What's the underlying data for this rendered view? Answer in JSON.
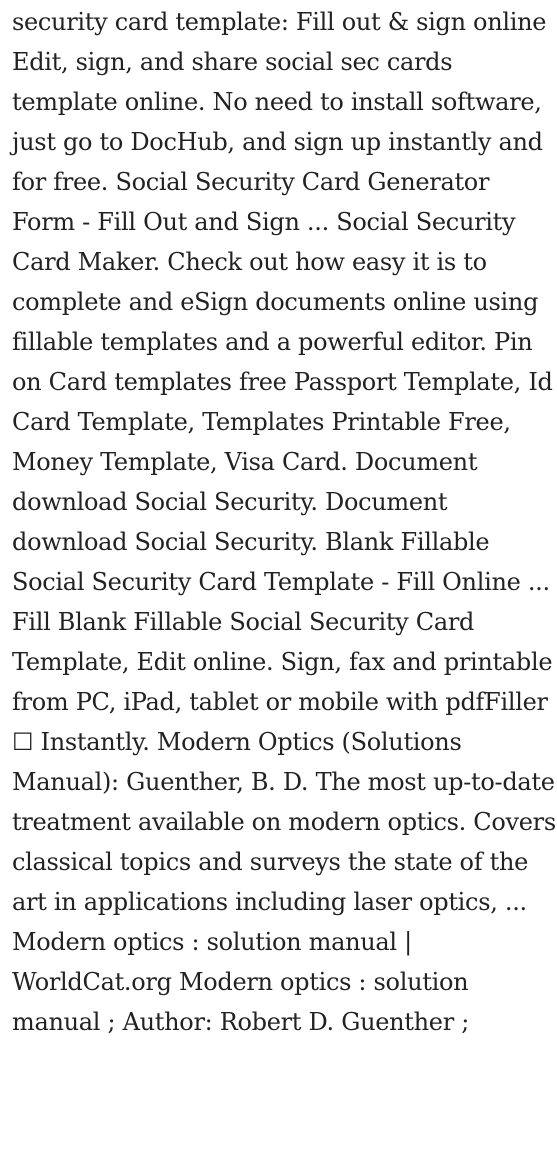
{
  "article": {
    "paragraph": "security card template: Fill out & sign online Edit, sign, and share social sec cards template online. No need to install software, just go to DocHub, and sign up instantly and for free. Social Security Card Generator Form - Fill Out and Sign ... Social Security Card Maker. Check out how easy it is to complete and eSign documents online using fillable templates and a powerful editor. Pin on Card templates free Passport Template, Id Card Template, Templates Printable Free, Money Template, Visa Card. Document download Social Security. Document download Social Security. Blank Fillable Social Security Card Template - Fill Online ... Fill Blank Fillable Social Security Card Template, Edit online. Sign, fax and printable from PC, iPad, tablet or mobile with pdfFiller ☐ Instantly. Modern Optics (Solutions Manual): Guenther, B. D. The most up-to-date treatment available on modern optics. Covers classical topics and surveys the state of the art in applications including laser optics, ... Modern optics : solution manual | WorldCat.org Modern optics : solution manual ; Author: Robert D. Guenther ;"
  }
}
